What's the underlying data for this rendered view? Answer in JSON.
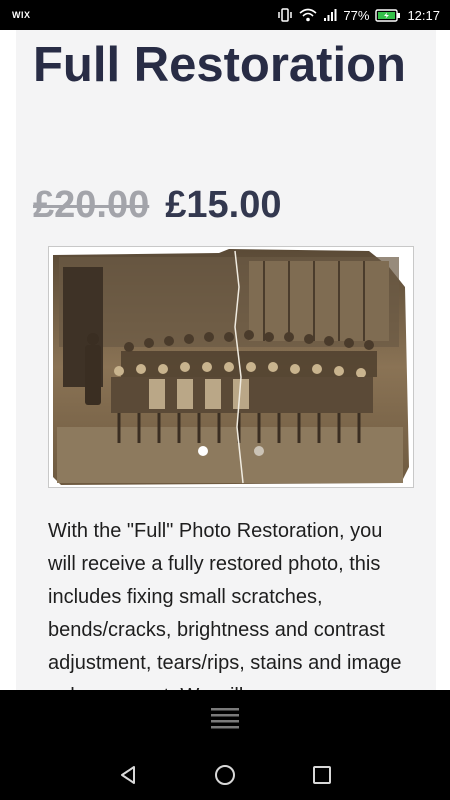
{
  "status_bar": {
    "left_label": "WIX",
    "battery_percent": "77%",
    "time": "12:17",
    "icons": [
      "vibrate-icon",
      "wifi-icon",
      "signal-icon",
      "battery-charging-icon"
    ]
  },
  "product": {
    "title": "Full Restoration",
    "old_price": "£20.00",
    "new_price": "£15.00",
    "description": "With the \"Full\" Photo Restoration, you will receive a fully restored photo, this includes fixing small scratches, bends/cracks, brightness and contrast adjustment, tears/rips, stains and image enhancement. We will"
  },
  "slider": {
    "image_alt": "Old sepia school class photo",
    "slide_count": 2,
    "active_slide": 1
  },
  "menu": {
    "icon": "hamburger-menu-icon"
  },
  "nav": {
    "icons": [
      "back-icon",
      "home-icon",
      "recents-icon"
    ]
  },
  "colors": {
    "title": "#282c45",
    "old_price": "#a3a4aa",
    "new_price": "#33384f",
    "card_bg": "#f4f4f5"
  }
}
